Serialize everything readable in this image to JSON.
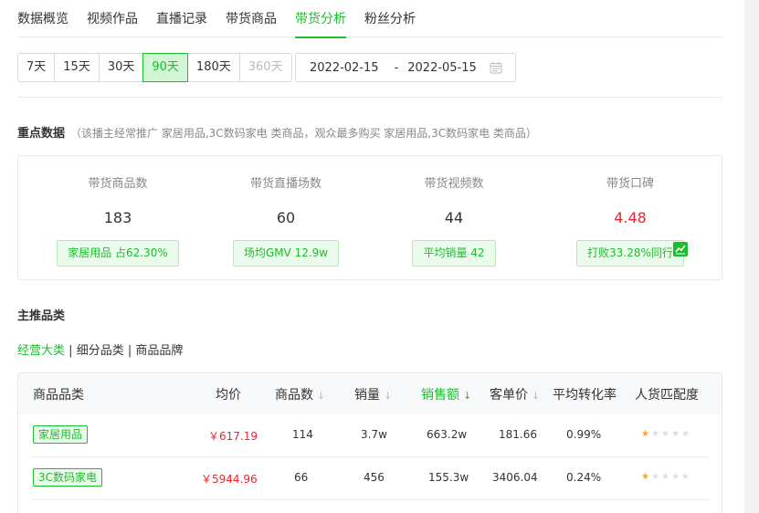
{
  "tabs": [
    "数据概览",
    "视频作品",
    "直播记录",
    "带货商品",
    "带货分析",
    "粉丝分析"
  ],
  "active_tab": 4,
  "ranges": [
    "7天",
    "15天",
    "30天",
    "90天",
    "180天",
    "360天"
  ],
  "active_range": 3,
  "date_range": {
    "start": "2022-02-15",
    "separator": "-",
    "end": "2022-05-15"
  },
  "key_data": {
    "title": "重点数据",
    "note": "（该播主经常推广 家居用品,3C数码家电 类商品，观众最多购买 家居用品,3C数码家电 类商品）",
    "metrics": [
      {
        "label": "带货商品数",
        "value": "183",
        "badge": "家居用品 占62.30%"
      },
      {
        "label": "带货直播场数",
        "value": "60",
        "badge": "场均GMV 12.9w"
      },
      {
        "label": "带货视频数",
        "value": "44",
        "badge": "平均销量 42"
      },
      {
        "label": "带货口碑",
        "value": "4.48",
        "badge": "打败33.28%同行"
      }
    ]
  },
  "main_category": {
    "title": "主推品类",
    "sub_tabs": [
      "经营大类",
      "细分品类",
      "商品品牌"
    ],
    "separator": "|"
  },
  "table": {
    "headers": [
      "商品品类",
      "均价",
      "商品数",
      "销量",
      "销售额",
      "客单价",
      "平均转化率",
      "人货匹配度"
    ],
    "sort_arrow": "↓",
    "rows": [
      {
        "category": "家居用品",
        "avg_price": "￥617.19",
        "count": "114",
        "sales": "3.7w",
        "revenue": "663.2w",
        "unit_price": "181.66",
        "conversion": "0.99%",
        "match_stars": 1
      },
      {
        "category": "3C数码家电",
        "avg_price": "￥5944.96",
        "count": "66",
        "sales": "456",
        "revenue": "155.3w",
        "unit_price": "3406.04",
        "conversion": "0.24%",
        "match_stars": 1
      }
    ]
  },
  "colors": {
    "accent": "#1cbd2f",
    "accent_bg": "#ebfbeb",
    "red": "#f5222d",
    "star": "#f5a623"
  },
  "icons": {
    "date": "calendar-icon",
    "trend": "trend-chart-icon",
    "sort": "sort-arrow-icon",
    "rating": "star-icon"
  }
}
